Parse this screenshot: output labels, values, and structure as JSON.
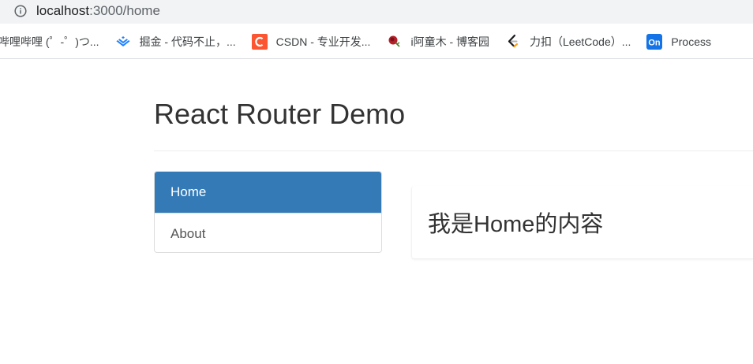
{
  "browser": {
    "url_host": "localhost",
    "url_path": ":3000/home",
    "bookmarks": [
      {
        "label": "哔哩哔哩 (゜-゜)つ...",
        "icon": "none"
      },
      {
        "label": "掘金 - 代码不止，...",
        "icon": "juejin-icon"
      },
      {
        "label": "CSDN - 专业开发...",
        "icon": "csdn-icon"
      },
      {
        "label": "i阿童木 - 博客园",
        "icon": "rose-icon"
      },
      {
        "label": "力扣（LeetCode）...",
        "icon": "leetcode-icon"
      },
      {
        "label": "Process",
        "icon": "processon-icon"
      }
    ]
  },
  "page": {
    "title": "React Router Demo",
    "nav": [
      {
        "label": "Home",
        "active": true
      },
      {
        "label": "About",
        "active": false
      }
    ],
    "content": {
      "heading": "我是Home的内容"
    }
  },
  "colors": {
    "active_nav_bg": "#337ab7",
    "active_nav_text": "#ffffff",
    "nav_text": "#555555",
    "title_text": "#333333",
    "csdn_red": "#fc5531",
    "juejin_blue": "#1e80ff",
    "processon_blue": "#1473e6"
  }
}
